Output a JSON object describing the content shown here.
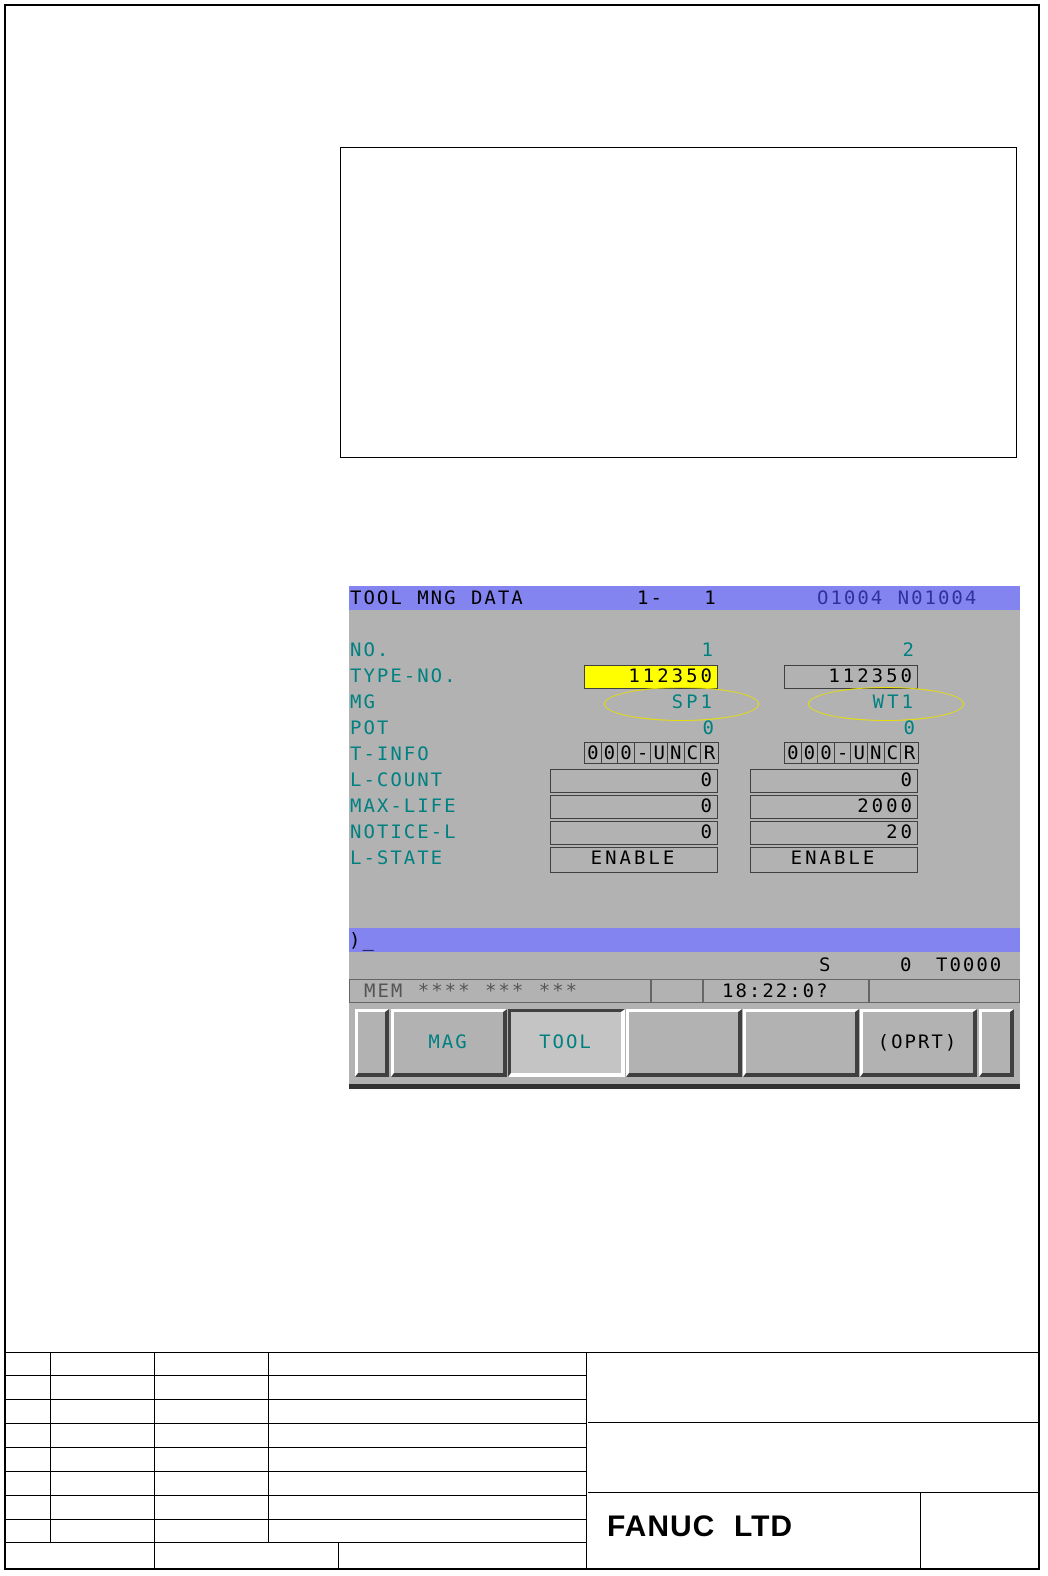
{
  "screen": {
    "title": "TOOL MNG DATA",
    "page": "1-   1",
    "program": "O1004 N01004",
    "rows": {
      "no": {
        "label": "NO.",
        "col1": "1",
        "col2": "2"
      },
      "type_no": {
        "label": "TYPE-NO.",
        "col1": "112350",
        "col2": "112350"
      },
      "mg": {
        "label": "MG",
        "col1": "SP1",
        "col2": "WT1"
      },
      "pot": {
        "label": "POT",
        "col1": "0",
        "col2": "0"
      },
      "t_info": {
        "label": "T-INFO",
        "col1": [
          "0",
          "0",
          "0",
          "-",
          "U",
          "N",
          "C",
          "R"
        ],
        "col2": [
          "0",
          "0",
          "0",
          "-",
          "U",
          "N",
          "C",
          "R"
        ]
      },
      "l_count": {
        "label": "L-COUNT",
        "col1": "0",
        "col2": "0"
      },
      "max_life": {
        "label": "MAX-LIFE",
        "col1": "0",
        "col2": "2000"
      },
      "notice_l": {
        "label": "NOTICE-L",
        "col1": "0",
        "col2": "20"
      },
      "l_state": {
        "label": "L-STATE",
        "col1": "ENABLE",
        "col2": "ENABLE"
      }
    },
    "input_prompt": ")_",
    "status": {
      "spindle_label": "S",
      "spindle_value": "0",
      "tool": "T0000"
    },
    "mode": {
      "text": "MEM **** *** ***",
      "time": "18:22:0?"
    },
    "softkeys": [
      "MAG",
      "TOOL",
      "",
      "",
      "(OPRT)"
    ],
    "colors": {
      "title_bar": "#8484f0",
      "screen_bg": "#b2b2b2",
      "label": "#008080",
      "highlight": "#ffff00",
      "circle": "#e8e000"
    }
  },
  "title_block": {
    "company": "FANUC  LTD"
  }
}
